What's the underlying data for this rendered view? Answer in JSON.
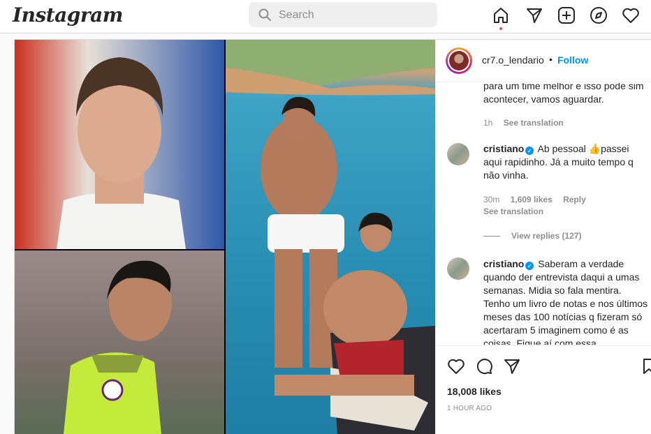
{
  "topbar": {
    "logo": "Instagram",
    "search_placeholder": "Search"
  },
  "post": {
    "username": "cr7.o_lendario",
    "separator": "•",
    "follow_label": "Follow",
    "comments": [
      {
        "text": "para um time melhor e isso pode sim acontecer, vamos aguardar.",
        "time": "1h",
        "see_translation": "See translation"
      },
      {
        "user": "cristiano",
        "text": "Ab pessoal 👍passei aqui rapidinho. Já a muito tempo q não vinha.",
        "time": "30m",
        "likes": "1,609 likes",
        "reply": "Reply",
        "see_translation": "See translation",
        "view_replies": "View replies (127)"
      },
      {
        "user": "cristiano",
        "text": "Saberam a verdade quando der entrevista daqui a umas semanas. Midia so fala mentira. Tenho um livro de notas e nos últimos meses das 100 notícias q fizeram só acertaram 5 imaginem como é as coisas. Fique aí com essa"
      }
    ],
    "likes_count": "18,008 likes",
    "posted_ago": "1 HOUR AGO"
  },
  "colors": {
    "accent": "#0095f6",
    "notification": "#ed4956"
  },
  "icons": [
    "search-icon",
    "home-icon",
    "direct-icon",
    "new-post-icon",
    "explore-icon",
    "activity-icon",
    "like-icon",
    "comment-icon",
    "share-icon",
    "save-icon",
    "verified-icon"
  ]
}
